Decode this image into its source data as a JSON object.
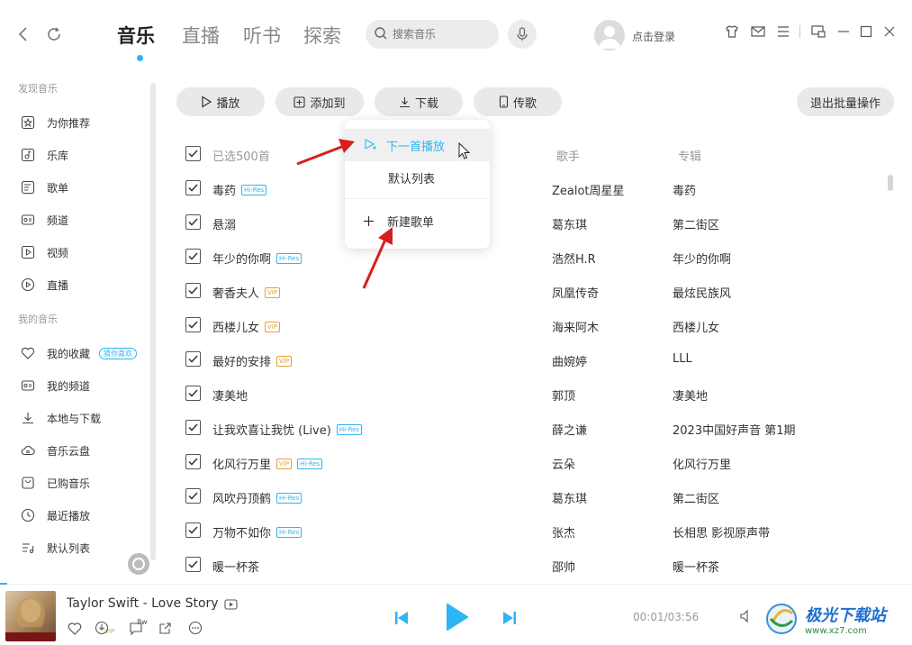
{
  "nav": {
    "back": "back-icon",
    "refresh": "refresh-icon"
  },
  "tabs": [
    {
      "label": "音乐",
      "active": true
    },
    {
      "label": "直播",
      "active": false
    },
    {
      "label": "听书",
      "active": false
    },
    {
      "label": "探索",
      "active": false
    }
  ],
  "search": {
    "placeholder": "搜索音乐"
  },
  "user": {
    "login_label": "点击登录"
  },
  "sidebar": {
    "discover_title": "发现音乐",
    "discover_items": [
      "为你推荐",
      "乐库",
      "歌单",
      "频道",
      "视频",
      "直播"
    ],
    "my_title": "我的音乐",
    "my_items": [
      "我的收藏",
      "我的频道",
      "本地与下载",
      "音乐云盘",
      "已购音乐",
      "最近播放",
      "默认列表"
    ],
    "guess_badge": "猜你喜欢"
  },
  "toolbar": {
    "play": "播放",
    "add_to": "添加到",
    "download": "下载",
    "transfer": "传歌",
    "exit_batch": "退出批量操作"
  },
  "table": {
    "selected_count": "已选500首",
    "col_artist": "歌手",
    "col_album": "专辑",
    "rows": [
      {
        "title": "毒药",
        "tags": [
          "Hi-Res"
        ],
        "artist": "Zealot周星星",
        "album": "毒药"
      },
      {
        "title": "悬溺",
        "tags": [],
        "artist": "葛东琪",
        "album": "第二街区"
      },
      {
        "title": "年少的你啊",
        "tags": [
          "Hi-Res"
        ],
        "artist": "浩然H.R",
        "album": "年少的你啊"
      },
      {
        "title": "奢香夫人",
        "tags": [
          "VIP"
        ],
        "artist": "凤凰传奇",
        "album": "最炫民族风"
      },
      {
        "title": "西楼儿女",
        "tags": [
          "VIP"
        ],
        "artist": "海来阿木",
        "album": "西楼儿女"
      },
      {
        "title": "最好的安排",
        "tags": [
          "VIP"
        ],
        "artist": "曲婉婷",
        "album": "LLL"
      },
      {
        "title": "凄美地",
        "tags": [],
        "artist": "郭顶",
        "album": "凄美地"
      },
      {
        "title": "让我欢喜让我忧 (Live)",
        "tags": [
          "Hi-Res"
        ],
        "artist": "薛之谦",
        "album": "2023中国好声音 第1期"
      },
      {
        "title": "化风行万里",
        "tags": [
          "VIP",
          "Hi-Res"
        ],
        "artist": "云朵",
        "album": "化风行万里"
      },
      {
        "title": "风吹丹顶鹤",
        "tags": [
          "Hi-Res"
        ],
        "artist": "葛东琪",
        "album": "第二街区"
      },
      {
        "title": "万物不如你",
        "tags": [
          "Hi-Res"
        ],
        "artist": "张杰",
        "album": "长相思 影视原声带"
      },
      {
        "title": "暖一杯茶",
        "tags": [],
        "artist": "邵帅",
        "album": "暖一杯茶"
      }
    ]
  },
  "dropdown": {
    "next_play": "下一首播放",
    "default_list": "默认列表",
    "new_playlist": "新建歌单"
  },
  "player": {
    "song": "Taylor Swift - Love Story",
    "time": "00:01/03:56",
    "comment_count": "8w"
  },
  "watermark": {
    "title": "极光下载站",
    "url": "www.xz7.com"
  },
  "colors": {
    "accent": "#2db5f4",
    "vip": "#e0a23a",
    "arrow": "#e02020"
  }
}
